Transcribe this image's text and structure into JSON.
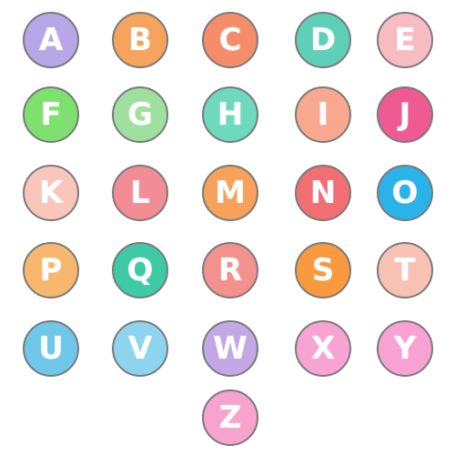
{
  "letters": [
    {
      "letter": "A",
      "color": "#b7a7e6"
    },
    {
      "letter": "B",
      "color": "#f6a35e"
    },
    {
      "letter": "C",
      "color": "#f58d6a"
    },
    {
      "letter": "D",
      "color": "#5fd0b8"
    },
    {
      "letter": "E",
      "color": "#f7bcc2"
    },
    {
      "letter": "F",
      "color": "#7ee06f"
    },
    {
      "letter": "G",
      "color": "#9fe0a0"
    },
    {
      "letter": "H",
      "color": "#6ed9bd"
    },
    {
      "letter": "I",
      "color": "#f8a88e"
    },
    {
      "letter": "J",
      "color": "#f05a92"
    },
    {
      "letter": "K",
      "color": "#f9c6bb"
    },
    {
      "letter": "L",
      "color": "#f38d95"
    },
    {
      "letter": "M",
      "color": "#f7a15a"
    },
    {
      "letter": "N",
      "color": "#f16e73"
    },
    {
      "letter": "O",
      "color": "#2ab3e8"
    },
    {
      "letter": "P",
      "color": "#f8b76f"
    },
    {
      "letter": "Q",
      "color": "#3fcaa6"
    },
    {
      "letter": "R",
      "color": "#f4918f"
    },
    {
      "letter": "S",
      "color": "#f99a3f"
    },
    {
      "letter": "T",
      "color": "#f7c2b4"
    },
    {
      "letter": "U",
      "color": "#6fc7ea"
    },
    {
      "letter": "V",
      "color": "#8ed4ef"
    },
    {
      "letter": "W",
      "color": "#c3a8e6"
    },
    {
      "letter": "X",
      "color": "#f8a4d3"
    },
    {
      "letter": "Y",
      "color": "#f7a2d2"
    },
    {
      "letter": "Z",
      "color": "#f7a3ce"
    }
  ]
}
